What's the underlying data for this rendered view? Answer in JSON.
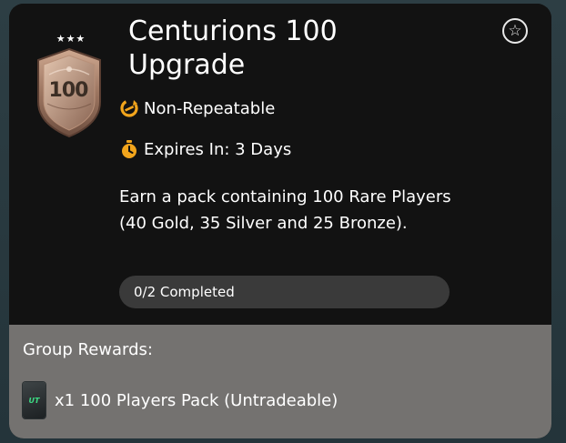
{
  "objective": {
    "badge_stars": "★★★",
    "badge_number": "100",
    "title_line1": "Centurions 100",
    "title_line2": "Upgrade",
    "repeat_text": "Non-Repeatable",
    "expires_text": "Expires In: 3 Days",
    "description": "Earn a pack containing 100 Rare Players (40 Gold, 35 Silver and 25 Bronze).",
    "progress_text": "0/2 Completed"
  },
  "rewards": {
    "label": "Group Rewards:",
    "items": [
      {
        "pack_logo": "UT",
        "text": "x1 100 Players Pack (Untradeable)"
      }
    ]
  },
  "icons": {
    "favorite": "star-outline-icon",
    "repeat": "repeat-icon",
    "timer": "stopwatch-icon"
  },
  "colors": {
    "card_top": "#121212",
    "card_bottom": "#747270",
    "accent_orange": "#f2a51c",
    "progress_bg": "#3a3a3a",
    "pack_logo": "#3ddc84"
  }
}
